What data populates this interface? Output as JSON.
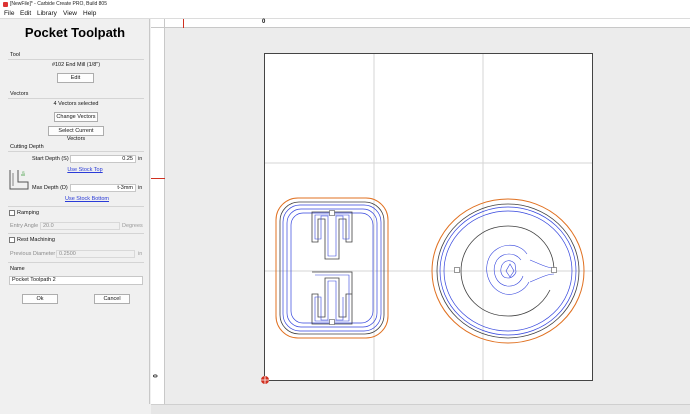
{
  "window": {
    "title": "[NewFile]* - Carbide Create PRO, Build 805"
  },
  "menu": {
    "items": [
      "File",
      "Edit",
      "Library",
      "View",
      "Help"
    ]
  },
  "panel": {
    "title": "Pocket Toolpath",
    "tool": {
      "section": "Tool",
      "name": "#102 End Mill (1/8\")",
      "edit_label": "Edit"
    },
    "vectors": {
      "section": "Vectors",
      "status": "4 Vectors selected",
      "change_label": "Change Vectors",
      "select_label": "Select Current Vectors"
    },
    "cutting_depth": {
      "section": "Cutting Depth",
      "start_label": "Start Depth (S)",
      "start_value": "0.25",
      "start_unit": "in",
      "use_stock_top": "Use Stock Top",
      "max_label": "Max Depth (D)",
      "max_value": "t-3mm",
      "max_unit": "in",
      "use_stock_bottom": "Use Stock Bottom"
    },
    "ramping": {
      "label": "Ramping",
      "angle_label": "Entry Angle",
      "angle_value": "20.0",
      "angle_unit": "Degrees"
    },
    "rest_machining": {
      "label": "Rest Machining",
      "diameter_label": "Previous Diameter",
      "diameter_value": "0.2500",
      "diameter_unit": "in"
    },
    "name": {
      "section": "Name",
      "value": "Pocket Toolpath 2"
    },
    "ok_label": "Ok",
    "cancel_label": "Cancel"
  },
  "rulers": {
    "top_zero": "0",
    "left_zero": "0"
  },
  "colors": {
    "accent_link": "#2a3bd8",
    "toolpath_blue": "#3344dd",
    "offset_orange": "#e07020",
    "vector_dark": "#404040",
    "origin_red": "#d03020"
  }
}
